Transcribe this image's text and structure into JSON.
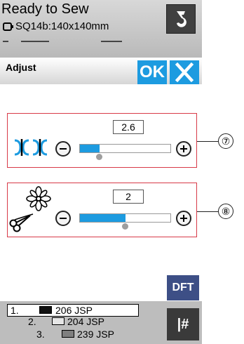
{
  "status_bar": {
    "title": "Ready to Sew",
    "hoop": "SQ14b:140x140mm"
  },
  "dialog": {
    "title": "Adjust",
    "ok_label": "OK"
  },
  "params": [
    {
      "icon": "stitch-width-icon",
      "value": "2.6",
      "level_fraction": 0.22
    },
    {
      "icon": "thread-cutter-icon",
      "value": "2",
      "level_fraction": 0.5
    }
  ],
  "dft_label": "DFT",
  "threads": [
    {
      "num": "1.",
      "label": "206 JSP",
      "color": "#111111",
      "selected": true
    },
    {
      "num": "2.",
      "label": "204 JSP",
      "color": "#e6e6e6",
      "selected": false
    },
    {
      "num": "3.",
      "label": "239 JSP",
      "color": "#7f7f7f",
      "selected": false
    }
  ],
  "jump_label": "|#",
  "callouts": [
    "⑦",
    "⑧"
  ],
  "colors": {
    "accent": "#1d9be0",
    "frame": "#d83a48",
    "dft": "#3d4f86"
  }
}
